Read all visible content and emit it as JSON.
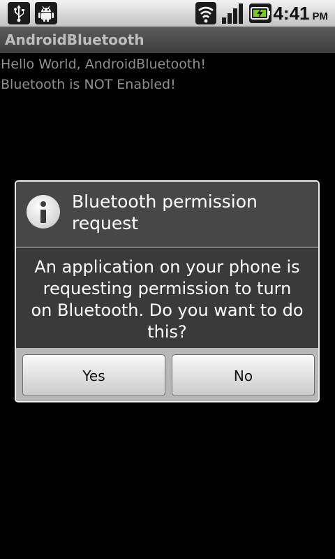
{
  "status_bar": {
    "icons": [
      "usb-icon",
      "android-debug-icon",
      "wifi-icon",
      "signal-icon",
      "battery-charging-icon"
    ],
    "time": "4:41",
    "ampm": "PM"
  },
  "app": {
    "title": "AndroidBluetooth"
  },
  "content": {
    "lines": [
      "Hello World, AndroidBluetooth!",
      "Bluetooth is NOT Enabled!"
    ]
  },
  "dialog": {
    "title": "Bluetooth permission request",
    "message": "An application on your phone is requesting permission to turn on Bluetooth. Do you want to do this?",
    "yes_label": "Yes",
    "no_label": "No"
  },
  "colors": {
    "status_bar_bg": "#d3d3d3",
    "title_bar_bg": "#4a4a4a",
    "content_text": "#8f8f8f",
    "dialog_bg": "#444444",
    "button_bg": "#e2e2e2"
  }
}
